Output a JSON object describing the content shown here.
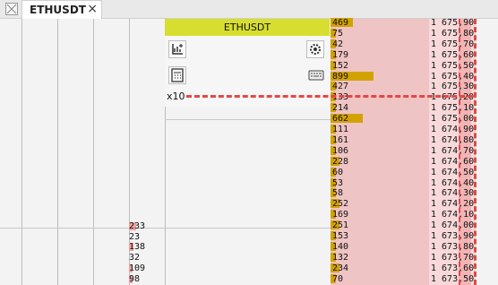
{
  "tab": {
    "label": "ETHUSDT",
    "close": "×"
  },
  "panel": {
    "title": "ETHUSDT",
    "multiplier": "x10"
  },
  "left_volumes": [
    "233",
    "23",
    "138",
    "32",
    "109",
    "98"
  ],
  "ladder": [
    {
      "vol": "469",
      "price": "1 675,90",
      "fill": 0.23
    },
    {
      "vol": "75",
      "price": "1 675,80",
      "fill": 0.0
    },
    {
      "vol": "42",
      "price": "1 675,70",
      "fill": 0.0
    },
    {
      "vol": "179",
      "price": "1 675,60",
      "fill": 0.03
    },
    {
      "vol": "152",
      "price": "1 675,50",
      "fill": 0.02
    },
    {
      "vol": "899",
      "price": "1 675,40",
      "fill": 0.44
    },
    {
      "vol": "427",
      "price": "1 675,30",
      "fill": 0.02
    },
    {
      "vol": "133",
      "price": "1 675,20",
      "fill": 0.02
    },
    {
      "vol": "214",
      "price": "1 675,10",
      "fill": 0.03
    },
    {
      "vol": "662",
      "price": "1 675,00",
      "fill": 0.33
    },
    {
      "vol": "111",
      "price": "1 674,90",
      "fill": 0.02
    },
    {
      "vol": "161",
      "price": "1 674,80",
      "fill": 0.02
    },
    {
      "vol": "106",
      "price": "1 674,70",
      "fill": 0.02
    },
    {
      "vol": "228",
      "price": "1 674,60",
      "fill": 0.09
    },
    {
      "vol": "60",
      "price": "1 674,50",
      "fill": 0.01
    },
    {
      "vol": "53",
      "price": "1 674,40",
      "fill": 0.01
    },
    {
      "vol": "58",
      "price": "1 674,30",
      "fill": 0.01
    },
    {
      "vol": "252",
      "price": "1 674,20",
      "fill": 0.09
    },
    {
      "vol": "169",
      "price": "1 674,10",
      "fill": 0.02
    },
    {
      "vol": "251",
      "price": "1 674,00",
      "fill": 0.09
    },
    {
      "vol": "153",
      "price": "1 673,90",
      "fill": 0.02
    },
    {
      "vol": "140",
      "price": "1 673,80",
      "fill": 0.02
    },
    {
      "vol": "132",
      "price": "1 673,70",
      "fill": 0.02
    },
    {
      "vol": "234",
      "price": "1 673,60",
      "fill": 0.09
    },
    {
      "vol": "70",
      "price": "1 673,50",
      "fill": 0.01
    }
  ],
  "colors": {
    "title_bar": "#d7de2f",
    "volume_bar": "#d2a300",
    "ask_bg": "#efc4c4",
    "dash": "#e24848"
  },
  "icons": [
    "chart-add-icon",
    "settings-gear-icon",
    "calculator-icon",
    "keyboard-icon",
    "window-close-icon"
  ]
}
